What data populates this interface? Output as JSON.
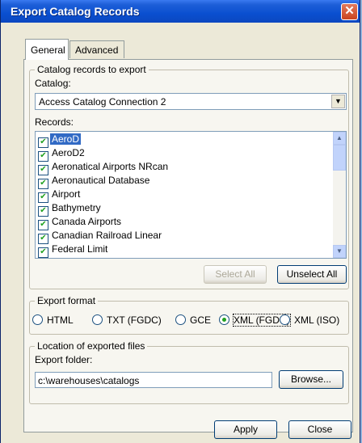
{
  "window": {
    "title": "Export Catalog Records"
  },
  "tabs": [
    {
      "label": "General",
      "active": true
    },
    {
      "label": "Advanced",
      "active": false
    }
  ],
  "catalog_group": {
    "title": "Catalog records to export",
    "catalog_label": "Catalog:",
    "catalog_value": "Access Catalog Connection 2",
    "records_label": "Records:",
    "records": [
      {
        "label": "AeroD",
        "checked": true,
        "selected": true
      },
      {
        "label": "AeroD2",
        "checked": true,
        "selected": false
      },
      {
        "label": "Aeronatical Airports NRcan",
        "checked": true,
        "selected": false
      },
      {
        "label": "Aeronautical Database",
        "checked": true,
        "selected": false
      },
      {
        "label": "Airport",
        "checked": true,
        "selected": false
      },
      {
        "label": "Bathymetry",
        "checked": true,
        "selected": false
      },
      {
        "label": "Canada Airports",
        "checked": true,
        "selected": false
      },
      {
        "label": "Canadian Railroad Linear",
        "checked": true,
        "selected": false
      },
      {
        "label": "Federal Limit",
        "checked": true,
        "selected": false
      }
    ],
    "select_all": "Select All",
    "unselect_all": "Unselect All"
  },
  "export_format": {
    "title": "Export format",
    "options": [
      {
        "label": "HTML",
        "selected": false
      },
      {
        "label": "TXT (FGDC)",
        "selected": false
      },
      {
        "label": "GCE",
        "selected": false
      },
      {
        "label": "XML (FGDC)",
        "selected": true
      },
      {
        "label": "XML (ISO)",
        "selected": false
      }
    ]
  },
  "location": {
    "title": "Location of exported files",
    "folder_label": "Export folder:",
    "folder_value": "c:\\warehouses\\catalogs",
    "browse": "Browse..."
  },
  "footer": {
    "apply": "Apply",
    "close": "Close"
  }
}
